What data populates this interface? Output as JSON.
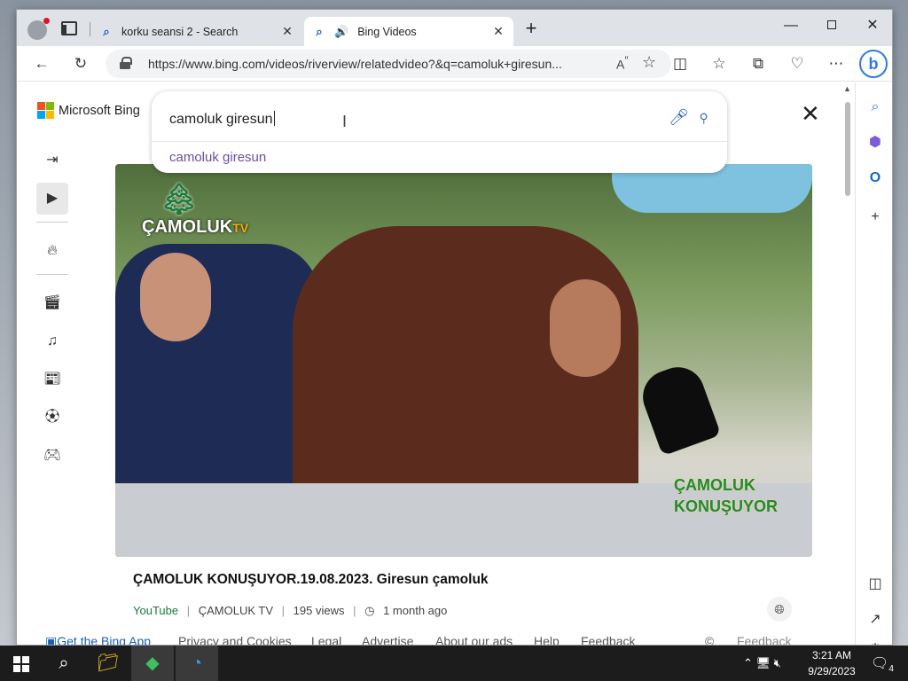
{
  "browser": {
    "tabs": [
      {
        "title": "korku seansi 2 - Search",
        "favicon": "search-icon"
      },
      {
        "title": "Bing Videos",
        "favicon": "search-icon",
        "audio": true
      }
    ],
    "url": "https://www.bing.com/videos/riverview/relatedvideo?&q=camoluk+giresun..."
  },
  "bing": {
    "logo_text": "Microsoft Bing",
    "search_query": "camoluk giresun",
    "suggestion": "camoluk giresun"
  },
  "video": {
    "overlay_brand": "ÇAMOLUK",
    "overlay_brand_tv": "TV",
    "overlay_bottom_line1": "ÇAMOLUK",
    "overlay_bottom_line2": "KONUŞUYOR",
    "title": "ÇAMOLUK KONUŞUYOR.19.08.2023. Giresun çamoluk",
    "source": "YouTube",
    "channel": "ÇAMOLUK TV",
    "views": "195 views",
    "age": "1 month ago"
  },
  "footer": {
    "get_app": "Get the Bing App",
    "privacy": "Privacy and Cookies",
    "legal": "Legal",
    "advertise": "Advertise",
    "about_ads": "About our ads",
    "help": "Help",
    "feedback": "Feedback",
    "copyright": "©",
    "feedback_button": "Feedback"
  },
  "taskbar": {
    "time": "3:21 AM",
    "date": "9/29/2023",
    "notifications": "4"
  },
  "colors": {
    "accent": "#1a5dbd",
    "suggestion": "#6b4ea0",
    "source": "#1a7a3a"
  }
}
